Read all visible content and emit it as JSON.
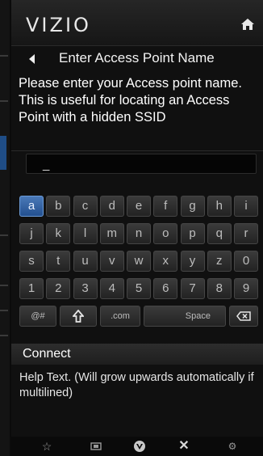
{
  "header": {
    "logo": "VIZIO",
    "home_icon": "home-icon"
  },
  "titlebar": {
    "back_icon": "back-arrow-icon",
    "title": "Enter Access Point Name"
  },
  "description": "Please enter your Access point name. This is useful for locating an Access Point with a hidden SSID",
  "input": {
    "value": "_"
  },
  "keyboard": {
    "selected_key": "a",
    "accent_color": "#2f5e9e",
    "rows": [
      [
        "a",
        "b",
        "c",
        "d",
        "e",
        "f",
        "g",
        "h",
        "i"
      ],
      [
        "j",
        "k",
        "l",
        "m",
        "n",
        "o",
        "p",
        "q",
        "r"
      ],
      [
        "s",
        "t",
        "u",
        "v",
        "w",
        "x",
        "y",
        "z",
        "0"
      ],
      [
        "1",
        "2",
        "3",
        "4",
        "5",
        "6",
        "7",
        "8",
        "9"
      ]
    ],
    "bottom_row": {
      "symbols": "@#",
      "shift_icon": "shift-arrow-icon",
      "dotcom": ".com",
      "space": "Space",
      "backspace_icon": "backspace-icon"
    }
  },
  "connect": {
    "label": "Connect"
  },
  "help_text": "Help Text. (Will grow upwards automatically if multilined)",
  "footer_icons": [
    "star-icon",
    "screen-icon",
    "vizio-v-icon",
    "close-icon",
    "gear-icon"
  ]
}
